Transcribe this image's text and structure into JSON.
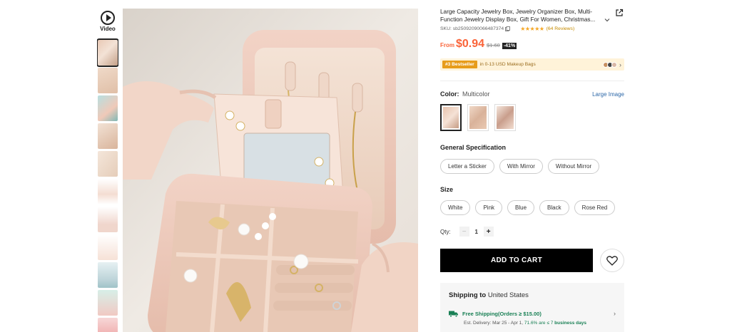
{
  "gallery": {
    "video_label": "Video",
    "thumbnails": [
      {
        "name": "thumb-1",
        "active": true
      },
      {
        "name": "thumb-2"
      },
      {
        "name": "thumb-3"
      },
      {
        "name": "thumb-4"
      },
      {
        "name": "thumb-5"
      },
      {
        "name": "thumb-6"
      },
      {
        "name": "thumb-7"
      },
      {
        "name": "thumb-8"
      },
      {
        "name": "thumb-9"
      },
      {
        "name": "thumb-10"
      },
      {
        "name": "thumb-11"
      }
    ]
  },
  "product": {
    "title": "Large Capacity Jewelry Box, Jewelry Organizer Box, Multi-Function Jewelry Display Box, Gift For Women, Christmas...",
    "sku": "SKU: sb25092090066487374",
    "rating_stars": "★★★★★",
    "reviews": "(64 Reviews)",
    "price_prefix": "From",
    "price": "$0.94",
    "original_price": "$1.60",
    "discount": "-41%"
  },
  "bestseller": {
    "badge": "#3 Bestseller",
    "category": "in 0-13 USD Makeup Bags",
    "arrow": "›"
  },
  "color": {
    "label": "Color:",
    "value": "Multicolor",
    "large_image_link": "Large Image"
  },
  "specification": {
    "title": "General Specification",
    "options": [
      "Letter a Sticker",
      "With Mirror",
      "Without Mirror"
    ]
  },
  "size": {
    "title": "Size",
    "options": [
      "White",
      "Pink",
      "Blue",
      "Black",
      "Rose Red"
    ]
  },
  "quantity": {
    "label": "Qty:",
    "minus": "−",
    "value": "1",
    "plus": "+"
  },
  "cart": {
    "add_to_cart": "ADD TO CART"
  },
  "shipping": {
    "title": "Shipping to",
    "destination": "United States",
    "free_shipping": "Free Shipping(Orders ≥  $15.00)",
    "est_prefix": "Est. Delivery: Mar 25 - Apr 1,",
    "est_pct": "71.6% are ≤ 7",
    "est_suffix": "business days",
    "arrow": "›"
  },
  "colors": {
    "price": "#fa6338",
    "bestseller_bg": "#fff3d9",
    "bestseller_badge": "#e79c1a",
    "link": "#2d68a8",
    "shipping_green": "#198055",
    "button": "#000000"
  }
}
